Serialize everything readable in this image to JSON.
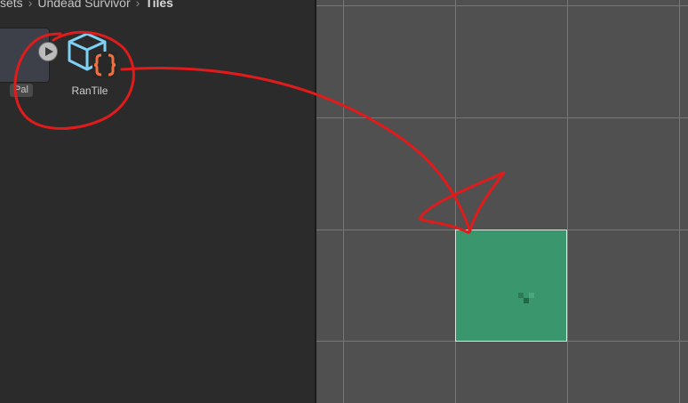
{
  "breadcrumb": {
    "items": [
      "sets",
      "Undead Survivor",
      "Tiles"
    ]
  },
  "assets": {
    "palette_label": "Pal",
    "rantile_label": "RanTile"
  },
  "colors": {
    "tile_fill": "#3a966d",
    "annotation": "#e01b1b",
    "script_icon": "#f07040",
    "prefab_icon": "#7fd0f5"
  }
}
